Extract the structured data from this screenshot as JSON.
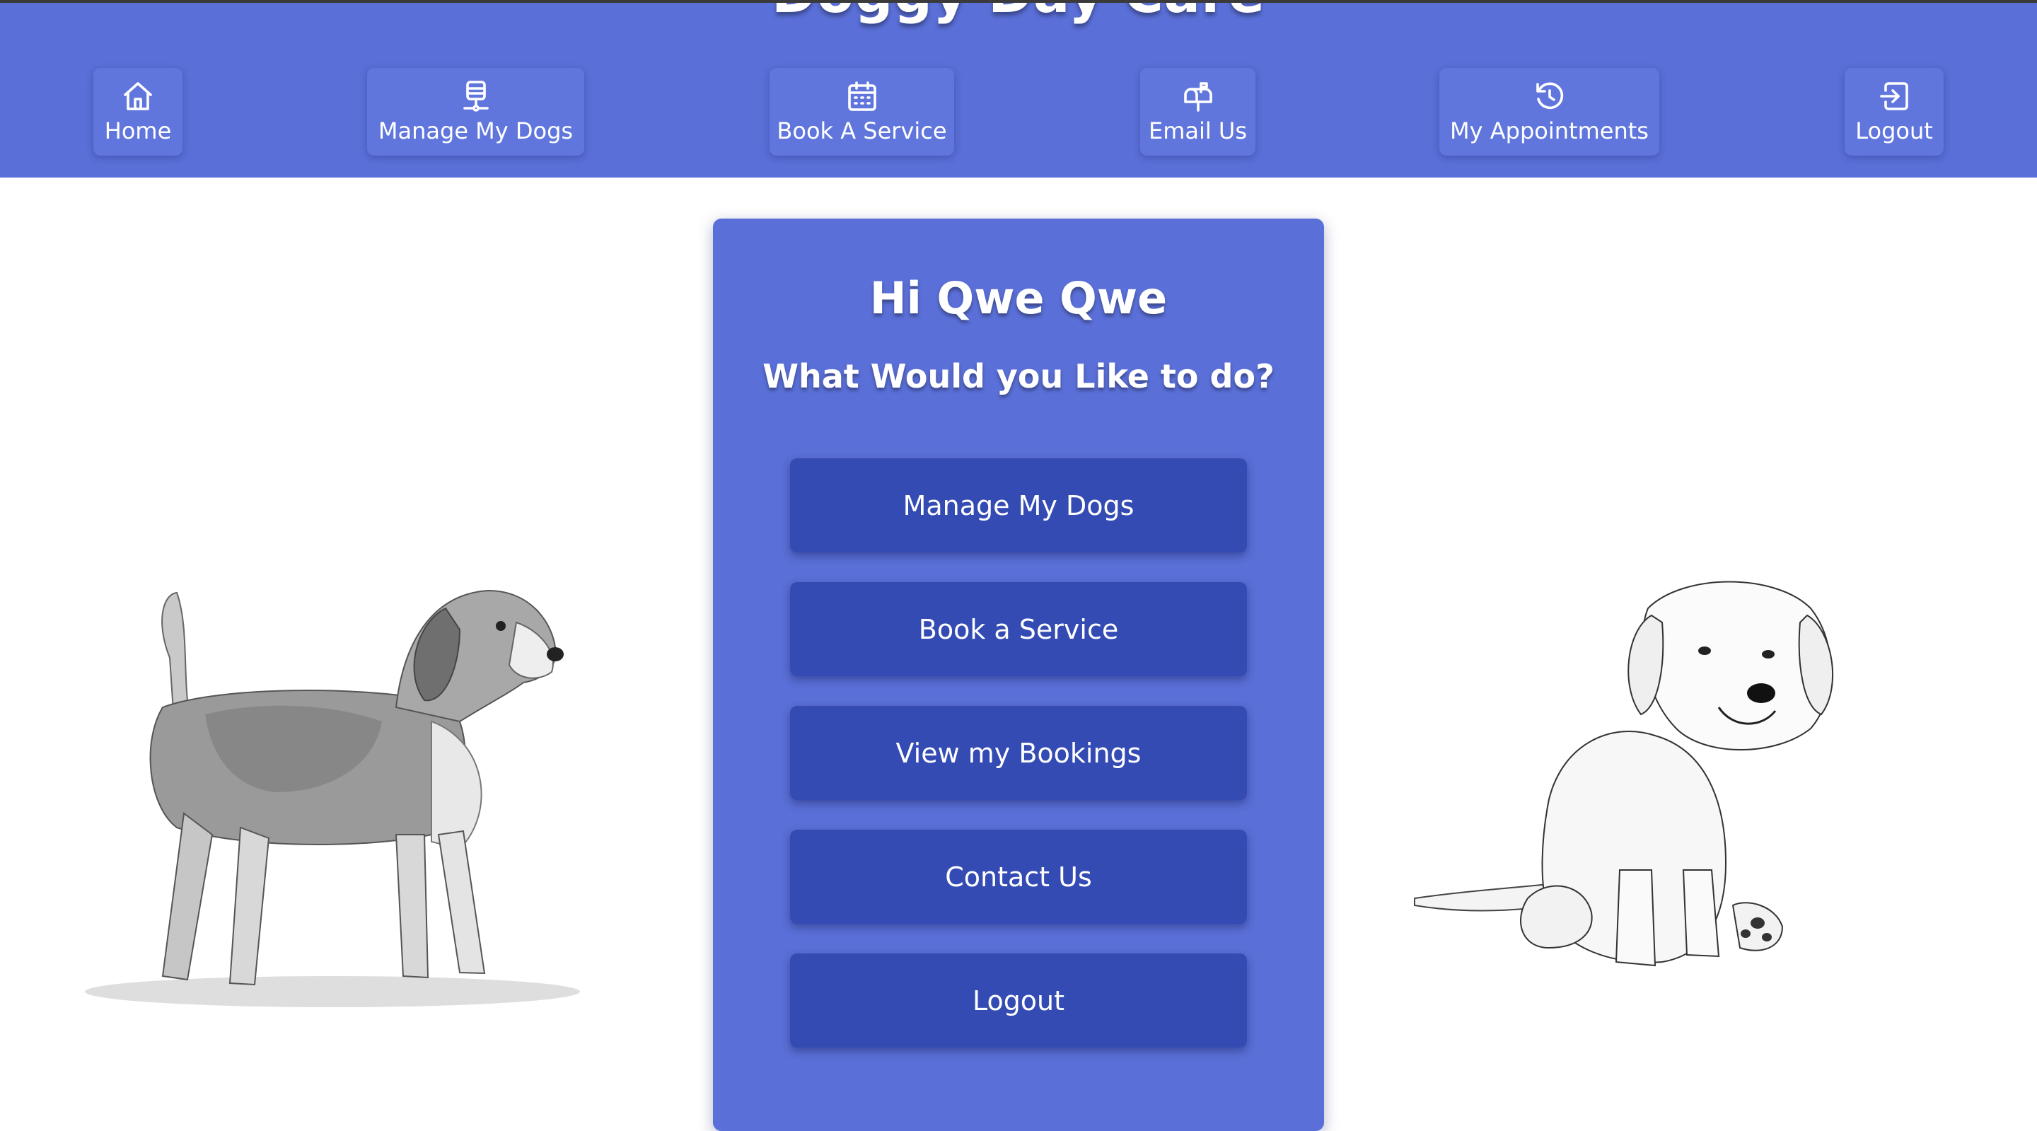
{
  "app": {
    "title": "Doggy Day Care",
    "colors": {
      "header": "#5a6fd7",
      "button": "#344bb4",
      "nav_button": "#6076dd",
      "text": "#ffffff"
    }
  },
  "nav": {
    "items": [
      {
        "label": "Home",
        "icon": "home-icon"
      },
      {
        "label": "Manage My Dogs",
        "icon": "dog-tag-icon"
      },
      {
        "label": "Book A Service",
        "icon": "calendar-icon"
      },
      {
        "label": "Email Us",
        "icon": "mailbox-icon"
      },
      {
        "label": "My Appointments",
        "icon": "history-icon"
      },
      {
        "label": "Logout",
        "icon": "logout-icon"
      }
    ]
  },
  "main": {
    "greeting": "Hi Qwe Qwe",
    "question": "What Would you Like to do?",
    "actions": [
      {
        "label": "Manage My Dogs"
      },
      {
        "label": "Book a Service"
      },
      {
        "label": "View my Bookings"
      },
      {
        "label": "Contact Us"
      },
      {
        "label": "Logout"
      }
    ]
  },
  "images": {
    "left": "beagle-sketch",
    "right": "puppy-sketch"
  }
}
